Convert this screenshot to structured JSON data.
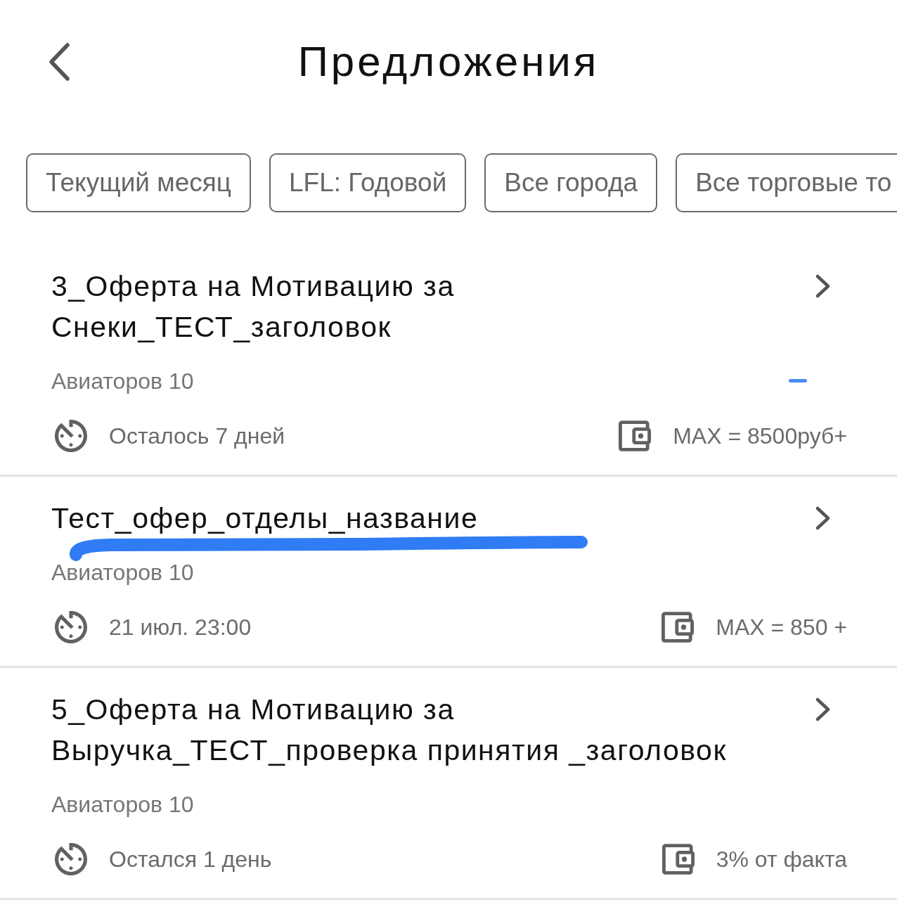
{
  "header": {
    "title": "Предложения"
  },
  "filters": [
    "Текущий месяц",
    "LFL: Годовой",
    "Все города",
    "Все торговые то"
  ],
  "offers": [
    {
      "title": "3_Оферта на Мотивацию за Снеки_ТЕСТ_заголовок",
      "location": "Авиаторов 10",
      "deadline": "Осталось 7 дней",
      "reward": "MAX = 8500руб+",
      "pen_mark": {
        "kind": "dash"
      }
    },
    {
      "title": "Тест_офер_отделы_название",
      "location": "Авиаторов 10",
      "deadline": "21 июл. 23:00",
      "reward": "MAX = 850 +",
      "pen_mark": {
        "kind": "underline"
      }
    },
    {
      "title": "5_Оферта на Мотивацию за Выручка_ТЕСТ_проверка принятия _заголовок",
      "location": "Авиаторов 10",
      "deadline": "Остался 1 день",
      "reward": "3% от факта"
    }
  ]
}
